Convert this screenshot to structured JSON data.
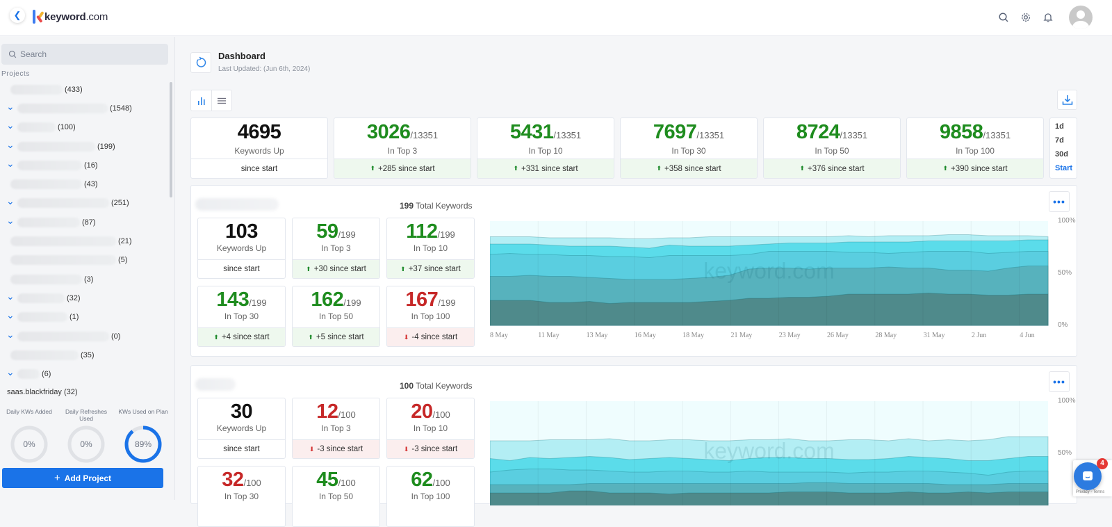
{
  "header": {
    "logo_text": "keyword",
    "logo_suffix": ".com",
    "icons": [
      "search-icon",
      "gear-icon",
      "bell-icon",
      "avatar"
    ]
  },
  "sidebar": {
    "search_placeholder": "Search",
    "projects_label": "Projects",
    "projects": [
      {
        "name_hidden": true,
        "count": "(433)",
        "expandable": false
      },
      {
        "name_hidden": true,
        "count": "(1548)",
        "expandable": true
      },
      {
        "name_hidden": true,
        "count": "(100)",
        "expandable": true
      },
      {
        "name_hidden": true,
        "count": "(199)",
        "expandable": true
      },
      {
        "name_hidden": true,
        "count": "(16)",
        "expandable": true
      },
      {
        "name_hidden": true,
        "count": "(43)",
        "expandable": false
      },
      {
        "name_hidden": true,
        "count": "(251)",
        "expandable": true
      },
      {
        "name_hidden": true,
        "count": "(87)",
        "expandable": true
      },
      {
        "name_hidden": true,
        "count": "(21)",
        "expandable": false
      },
      {
        "name_hidden": true,
        "count": "(5)",
        "expandable": false
      },
      {
        "name_hidden": true,
        "count": "(3)",
        "expandable": false
      },
      {
        "name_hidden": true,
        "count": "(32)",
        "expandable": true
      },
      {
        "name_hidden": true,
        "count": "(1)",
        "expandable": true
      },
      {
        "name_hidden": true,
        "count": "(0)",
        "expandable": true
      },
      {
        "name_hidden": true,
        "count": "(35)",
        "expandable": false
      },
      {
        "name_hidden": true,
        "count": "(6)",
        "expandable": true
      }
    ],
    "last_project": {
      "name": "saas.blackfriday",
      "count": "(32)"
    },
    "gauges": [
      {
        "label": "Daily KWs Added",
        "value": "0%",
        "fraction": 0
      },
      {
        "label": "Daily Refreshes Used",
        "value": "0%",
        "fraction": 0
      },
      {
        "label": "KWs Used on Plan",
        "value": "89%",
        "fraction": 0.89
      }
    ],
    "add_project_label": "Add Project"
  },
  "dashboard": {
    "title": "Dashboard",
    "last_updated": "Last Updated: (Jun 6th, 2024)",
    "summary": [
      {
        "value": "4695",
        "total": "",
        "label": "Keywords Up",
        "change": "since start",
        "trend": "none",
        "color": "black"
      },
      {
        "value": "3026",
        "total": "/13351",
        "label": "In Top 3",
        "change": "+285 since start",
        "trend": "up",
        "color": "green"
      },
      {
        "value": "5431",
        "total": "/13351",
        "label": "In Top 10",
        "change": "+331 since start",
        "trend": "up",
        "color": "green"
      },
      {
        "value": "7697",
        "total": "/13351",
        "label": "In Top 30",
        "change": "+358 since start",
        "trend": "up",
        "color": "green"
      },
      {
        "value": "8724",
        "total": "/13351",
        "label": "In Top 50",
        "change": "+376 since start",
        "trend": "up",
        "color": "green"
      },
      {
        "value": "9858",
        "total": "/13351",
        "label": "In Top 100",
        "change": "+390 since start",
        "trend": "up",
        "color": "green"
      }
    ],
    "periods": [
      "1d",
      "7d",
      "30d",
      "Start"
    ],
    "active_period": "Start"
  },
  "projects_panels": [
    {
      "total_keywords": "199",
      "total_label": "Total Keywords",
      "stats": [
        {
          "value": "103",
          "total": "",
          "label": "Keywords Up",
          "change": "since start",
          "trend": "none",
          "color": "black"
        },
        {
          "value": "59",
          "total": "/199",
          "label": "In Top 3",
          "change": "+30 since start",
          "trend": "up",
          "color": "green"
        },
        {
          "value": "112",
          "total": "/199",
          "label": "In Top 10",
          "change": "+37 since start",
          "trend": "up",
          "color": "green"
        },
        {
          "value": "143",
          "total": "/199",
          "label": "In Top 30",
          "change": "+4 since start",
          "trend": "up",
          "color": "green"
        },
        {
          "value": "162",
          "total": "/199",
          "label": "In Top 50",
          "change": "+5 since start",
          "trend": "up",
          "color": "green"
        },
        {
          "value": "167",
          "total": "/199",
          "label": "In Top 100",
          "change": "-4 since start",
          "trend": "down",
          "color": "red"
        }
      ]
    },
    {
      "total_keywords": "100",
      "total_label": "Total Keywords",
      "stats": [
        {
          "value": "30",
          "total": "",
          "label": "Keywords Up",
          "change": "since start",
          "trend": "none",
          "color": "black"
        },
        {
          "value": "12",
          "total": "/100",
          "label": "In Top 3",
          "change": "-3 since start",
          "trend": "down",
          "color": "red"
        },
        {
          "value": "20",
          "total": "/100",
          "label": "In Top 10",
          "change": "-3 since start",
          "trend": "down",
          "color": "red"
        },
        {
          "value": "32",
          "total": "/100",
          "label": "In Top 30",
          "change": "",
          "trend": "none",
          "color": "red"
        },
        {
          "value": "45",
          "total": "/100",
          "label": "In Top 50",
          "change": "",
          "trend": "none",
          "color": "green"
        },
        {
          "value": "62",
          "total": "/100",
          "label": "In Top 100",
          "change": "",
          "trend": "none",
          "color": "green"
        }
      ]
    }
  ],
  "chart_data": [
    {
      "type": "area",
      "stacked": true,
      "watermark": "keyword.com",
      "x": [
        "8 May",
        "9 May",
        "10 May",
        "11 May",
        "12 May",
        "13 May",
        "14 May",
        "15 May",
        "16 May",
        "17 May",
        "18 May",
        "19 May",
        "20 May",
        "21 May",
        "22 May",
        "23 May",
        "24 May",
        "25 May",
        "26 May",
        "27 May",
        "28 May",
        "29 May",
        "30 May",
        "31 May",
        "1 Jun",
        "2 Jun",
        "3 Jun",
        "4 Jun",
        "5 Jun"
      ],
      "x_tick_labels": [
        "8 May",
        "11 May",
        "13 May",
        "16 May",
        "18 May",
        "21 May",
        "23 May",
        "26 May",
        "28 May",
        "31 May",
        "2 Jun",
        "4 Jun"
      ],
      "y_tick_labels": [
        "100%",
        "50%",
        "0%"
      ],
      "ylim": [
        0,
        100
      ],
      "series": [
        {
          "name": "Top 3",
          "color": "#4f8a8b",
          "values": [
            24,
            24,
            24,
            22,
            22,
            23,
            21,
            22,
            22,
            22,
            22,
            23,
            24,
            26,
            26,
            27,
            27,
            28,
            30,
            30,
            30,
            30,
            31,
            30,
            30,
            29,
            29,
            30,
            30
          ]
        },
        {
          "name": "Top 10",
          "color": "#57b2bd",
          "values": [
            47,
            47,
            48,
            47,
            47,
            46,
            45,
            44,
            44,
            44,
            45,
            46,
            48,
            54,
            55,
            55,
            54,
            55,
            55,
            55,
            56,
            55,
            55,
            53,
            53,
            52,
            55,
            57,
            57
          ]
        },
        {
          "name": "Top 30",
          "color": "#5acee0",
          "values": [
            68,
            69,
            68,
            68,
            67,
            67,
            66,
            66,
            65,
            67,
            67,
            67,
            67,
            68,
            71,
            71,
            71,
            71,
            70,
            70,
            69,
            70,
            71,
            71,
            71,
            69,
            70,
            71,
            71
          ]
        },
        {
          "name": "Top 50",
          "color": "#5bdcea",
          "values": [
            78,
            78,
            78,
            77,
            76,
            76,
            76,
            75,
            74,
            77,
            76,
            76,
            76,
            77,
            78,
            79,
            79,
            79,
            80,
            80,
            80,
            80,
            81,
            81,
            81,
            81,
            81,
            82,
            82
          ]
        },
        {
          "name": "Top 100",
          "color": "#b3eef4",
          "values": [
            85,
            85,
            85,
            84,
            84,
            84,
            84,
            83,
            83,
            84,
            84,
            85,
            85,
            85,
            85,
            85,
            85,
            85,
            86,
            85,
            86,
            86,
            86,
            87,
            87,
            86,
            86,
            86,
            85
          ]
        }
      ]
    },
    {
      "type": "area",
      "stacked": true,
      "watermark": "keyword.com",
      "y_tick_labels": [
        "100%",
        "50%"
      ],
      "ylim": [
        0,
        100
      ],
      "series": [
        {
          "name": "Top 3",
          "color": "#4f8a8b",
          "values": [
            12,
            12,
            12,
            12,
            14,
            14,
            12,
            12,
            12,
            11,
            12,
            12,
            12,
            12,
            12,
            13,
            13,
            13,
            12,
            12,
            12,
            13,
            12,
            12,
            13,
            12,
            13,
            13,
            13
          ]
        },
        {
          "name": "Top 10",
          "color": "#57b2bd",
          "values": [
            20,
            20,
            20,
            20,
            20,
            21,
            21,
            21,
            21,
            21,
            21,
            21,
            21,
            21,
            21,
            21,
            22,
            22,
            21,
            21,
            21,
            21,
            21,
            20,
            20,
            20,
            21,
            21,
            21
          ]
        },
        {
          "name": "Top 30",
          "color": "#5acee0",
          "values": [
            32,
            34,
            35,
            35,
            34,
            34,
            33,
            32,
            32,
            33,
            33,
            32,
            32,
            33,
            32,
            32,
            32,
            32,
            31,
            32,
            32,
            33,
            33,
            32,
            31,
            29,
            32,
            33,
            33
          ]
        },
        {
          "name": "Top 50",
          "color": "#5bdcea",
          "values": [
            45,
            43,
            46,
            45,
            46,
            47,
            46,
            44,
            45,
            46,
            45,
            44,
            43,
            45,
            46,
            46,
            45,
            45,
            44,
            44,
            45,
            47,
            46,
            45,
            43,
            43,
            45,
            47,
            47
          ]
        },
        {
          "name": "Top 100",
          "color": "#b3eef4",
          "values": [
            62,
            62,
            62,
            63,
            63,
            63,
            64,
            62,
            62,
            63,
            63,
            62,
            62,
            63,
            63,
            64,
            62,
            62,
            63,
            63,
            62,
            64,
            62,
            63,
            62,
            63,
            66,
            66,
            66
          ]
        }
      ]
    }
  ]
}
